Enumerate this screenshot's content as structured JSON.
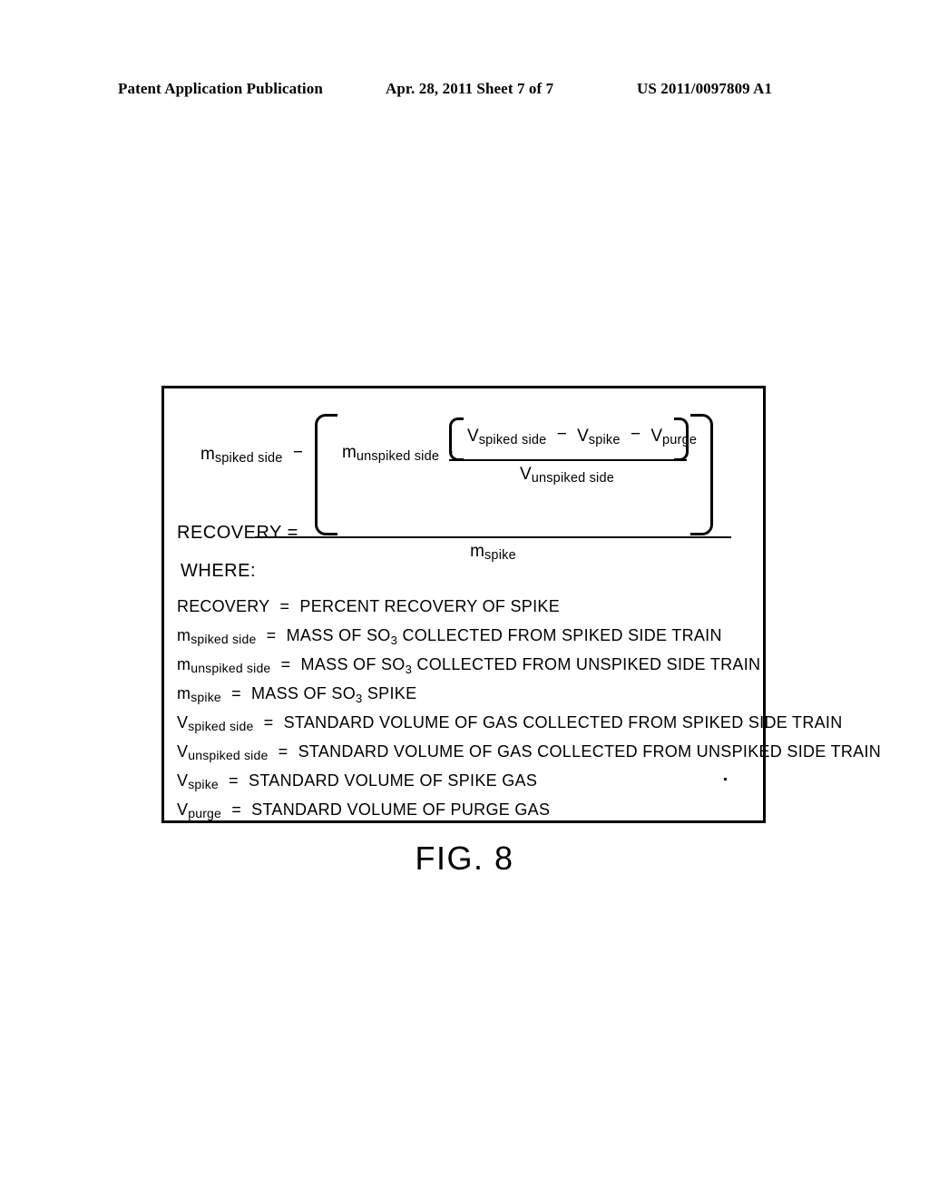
{
  "header": {
    "publication": "Patent Application Publication",
    "date_sheet": "Apr. 28, 2011  Sheet 7 of 7",
    "publication_number": "US 2011/0097809 A1"
  },
  "figure": {
    "caption": "FIG. 8",
    "equation": {
      "result_label": "RECOVERY",
      "equals": "=",
      "numerator": {
        "term1_base": "m",
        "term1_sub": "spiked side",
        "operator1": "−",
        "term2_base": "m",
        "term2_sub": "unspiked side",
        "operator2": "·",
        "inner_fraction": {
          "numerator": {
            "t1_base": "V",
            "t1_sub": "spiked side",
            "op1": "−",
            "t2_base": "V",
            "t2_sub": "spike",
            "op2": "−",
            "t3_base": "V",
            "t3_sub": "purge"
          },
          "denominator_base": "V",
          "denominator_sub": "unspiked side"
        }
      },
      "denominator_base": "m",
      "denominator_sub": "spike"
    },
    "where_label": "WHERE:",
    "definitions": [
      {
        "symbol_base": "RECOVERY",
        "symbol_sub": "",
        "equals": "=",
        "text": "PERCENT RECOVERY OF SPIKE"
      },
      {
        "symbol_base": "m",
        "symbol_sub": "spiked side",
        "equals": "=",
        "text_pre": "MASS OF SO",
        "text_subnum": "3",
        "text_post": " COLLECTED FROM  SPIKED  SIDE  TRAIN"
      },
      {
        "symbol_base": "m",
        "symbol_sub": "unspiked side",
        "equals": "=",
        "text_pre": "MASS OF SO",
        "text_subnum": "3",
        "text_post": " COLLECTED  FROM  UNSPIKED  SIDE  TRAIN"
      },
      {
        "symbol_base": "m",
        "symbol_sub": "spike",
        "equals": "=",
        "text_pre": "MASS OF SO",
        "text_subnum": "3",
        "text_post": " SPIKE"
      },
      {
        "symbol_base": "V",
        "symbol_sub": "spiked side",
        "equals": "=",
        "text": "STANDARD  VOLUME OF GAS COLLECTED FROM  SPIKED  SIDE  TRAIN"
      },
      {
        "symbol_base": "V",
        "symbol_sub": "unspiked side",
        "equals": "=",
        "text": "STANDARD  VOLUME OF GAS COLLECTED FROM  UNSPIKED  SIDE  TRAIN"
      },
      {
        "symbol_base": "V",
        "symbol_sub": "spike",
        "equals": "=",
        "text": "STANDARD  VOLUME OF SPIKE GAS"
      },
      {
        "symbol_base": "V",
        "symbol_sub": "purge",
        "equals": "=",
        "text": "STANDARD  VOLUME OF PURGE GAS"
      }
    ]
  },
  "colors": {
    "ink": "#000000",
    "paper": "#ffffff"
  }
}
